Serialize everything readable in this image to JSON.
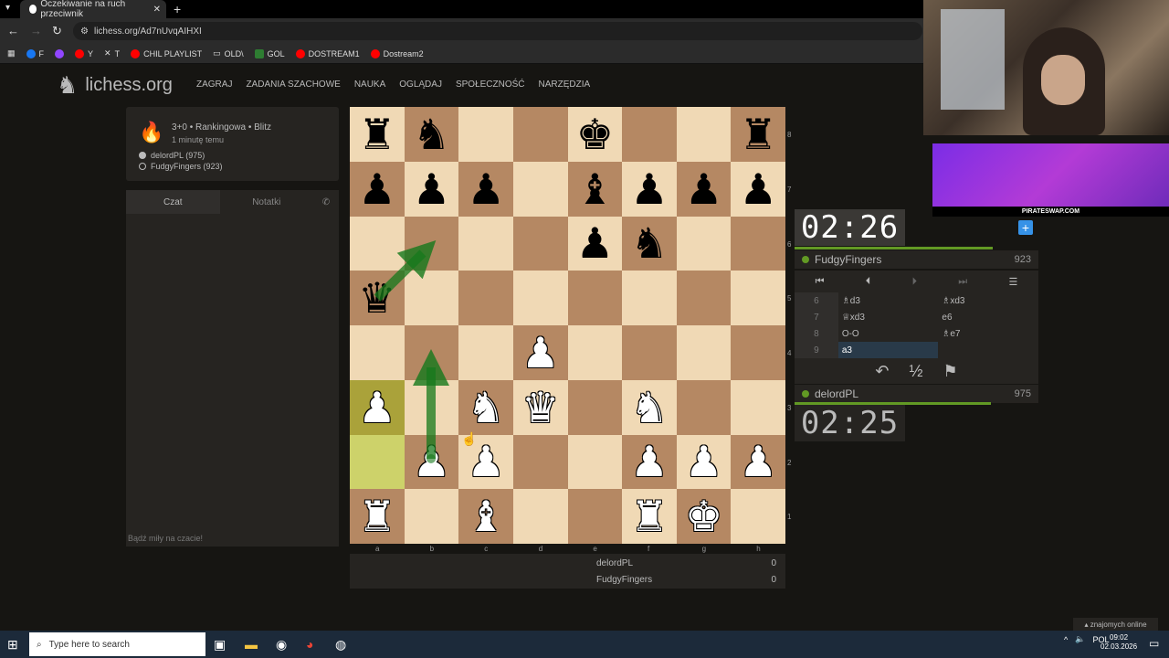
{
  "browser": {
    "tab_title": "Oczekiwanie na ruch przeciwnik",
    "url": "lichess.org/Ad7nUvqAIHXI",
    "bookmarks": [
      "F",
      "Y",
      "T",
      "CHIL PLAYLIST",
      "OLD\\",
      "GOL",
      "DOSTREAM1",
      "Dostream2"
    ]
  },
  "site": {
    "logo": "lichess.org",
    "nav": [
      "ZAGRAJ",
      "ZADANIA SZACHOWE",
      "NAUKA",
      "OGLĄDAJ",
      "SPOŁECZNOŚĆ",
      "NARZĘDZIA"
    ]
  },
  "game_info": {
    "title": "3+0 • Rankingowa • Blitz",
    "time_ago": "1 minutę temu",
    "white": "delordPL (975)",
    "black": "FudgyFingers (923)"
  },
  "chat": {
    "tab_chat": "Czat",
    "tab_notes": "Notatki",
    "placeholder": "Bądź miły na czacie!"
  },
  "board": {
    "ranks": [
      "8",
      "7",
      "6",
      "5",
      "4",
      "3",
      "2",
      "1"
    ],
    "files": [
      "a",
      "b",
      "c",
      "d",
      "e",
      "f",
      "g",
      "h"
    ],
    "rows": [
      [
        "r",
        "n",
        "",
        "",
        "k",
        "",
        "",
        "r"
      ],
      [
        "p",
        "p",
        "p",
        "",
        "b",
        "p",
        "p",
        "p"
      ],
      [
        "",
        "",
        "",
        "",
        "p",
        "n",
        "",
        ""
      ],
      [
        "q",
        "",
        "",
        "",
        "",
        "",
        "",
        ""
      ],
      [
        "",
        "",
        "",
        "P",
        "",
        "",
        "",
        ""
      ],
      [
        "P",
        "",
        "N",
        "Q",
        "",
        "N",
        "",
        ""
      ],
      [
        "",
        "P",
        "P",
        "",
        "",
        "P",
        "P",
        "P"
      ],
      [
        "R",
        "",
        "B",
        "",
        "",
        "R",
        "K",
        ""
      ]
    ],
    "highlight": [
      "a3",
      "a2"
    ]
  },
  "scoreboard": [
    {
      "name": "delordPL",
      "score": "0"
    },
    {
      "name": "FudgyFingers",
      "score": "0"
    }
  ],
  "clocks": {
    "opponent_time": "02:26",
    "player_time": "02:25"
  },
  "opponent": {
    "name": "FudgyFingers",
    "rating": "923"
  },
  "player": {
    "name": "delordPL",
    "rating": "975"
  },
  "moves": [
    {
      "no": "6",
      "white": "♗d3",
      "black": "♗xd3"
    },
    {
      "no": "7",
      "white": "♕xd3",
      "black": "e6"
    },
    {
      "no": "8",
      "white": "O-O",
      "black": "♗e7"
    },
    {
      "no": "9",
      "white": "a3",
      "black": ""
    }
  ],
  "webcam_ad": {
    "text": "PIRATESWAP.COM"
  },
  "friends": "znajomych online",
  "taskbar": {
    "search_placeholder": "Type here to search",
    "lang": "POL",
    "time": "09:02",
    "date": "02.03.2026"
  },
  "colors": {
    "light_square": "#f0d9b5",
    "dark_square": "#b58863",
    "highlight": "#cdd26a",
    "arrow": "#15781b",
    "online": "#629924"
  }
}
